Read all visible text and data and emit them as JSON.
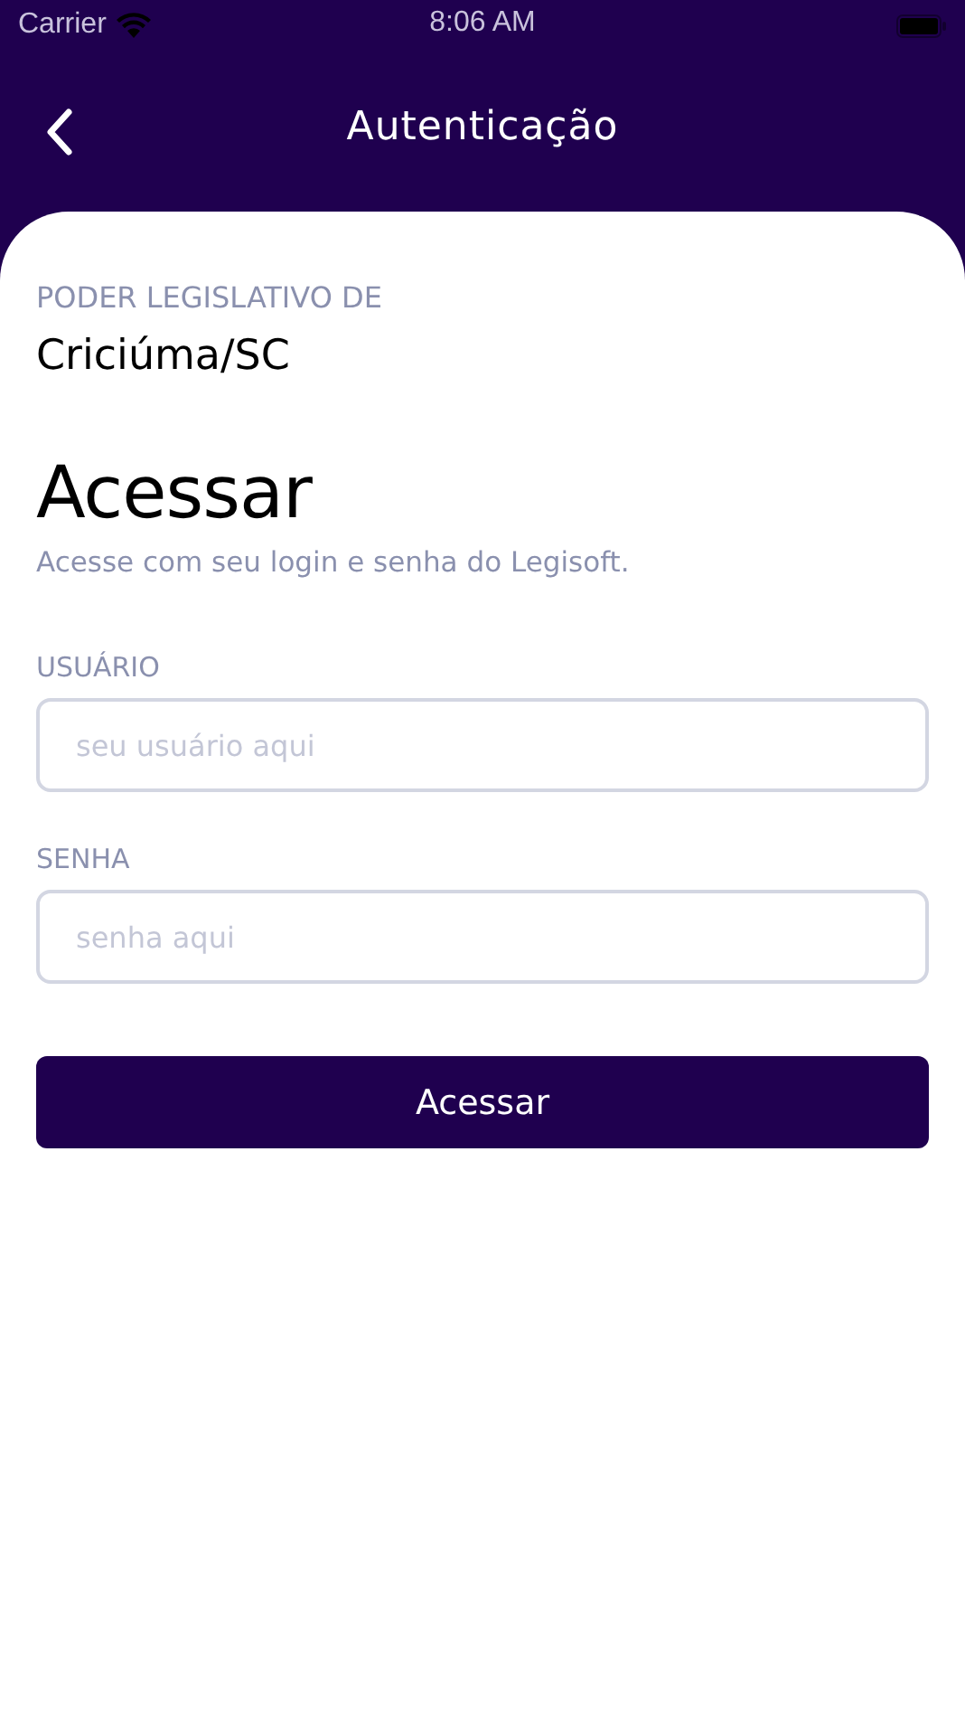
{
  "status_bar": {
    "carrier": "Carrier",
    "time": "8:06 AM"
  },
  "nav": {
    "title": "Autenticação"
  },
  "org": {
    "label": "PODER LEGISLATIVO DE",
    "name": "Criciúma/SC"
  },
  "heading": "Acessar",
  "subtitle": "Acesse com seu login e senha do Legisoft.",
  "fields": [
    {
      "label": "USUÁRIO",
      "placeholder": "seu usuário aqui"
    },
    {
      "label": "SENHA",
      "placeholder": "senha aqui"
    }
  ],
  "submit": "Acessar"
}
